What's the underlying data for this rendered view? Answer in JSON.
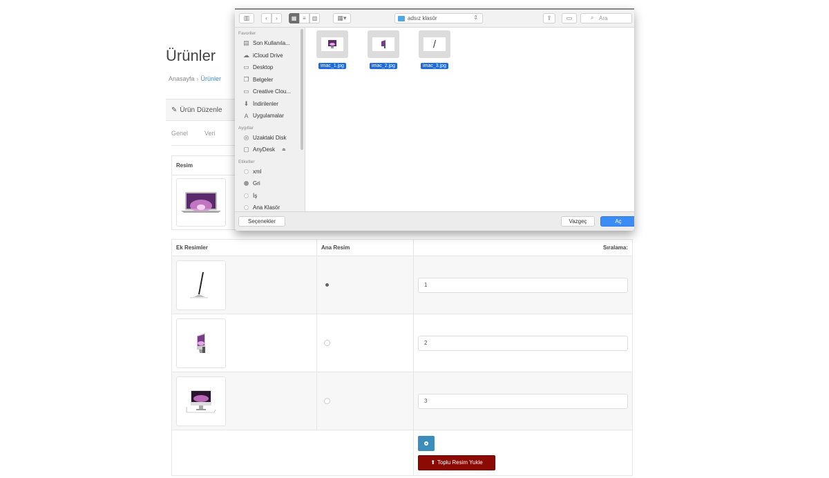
{
  "page": {
    "title": "Ürünler",
    "breadcrumb": [
      {
        "label": "Anasayfa"
      },
      {
        "label": "Ürünler"
      }
    ],
    "breadcrumb_separator": "›",
    "panel_title": "Ürün Düzenle",
    "panel_icon": "pencil-icon",
    "tabs": [
      {
        "label": "Genel"
      },
      {
        "label": "Veri"
      }
    ],
    "main_image": {
      "header": "Resim",
      "image": "macbook-air-image"
    },
    "additional_images": {
      "headers": {
        "images": "Ek Resimler",
        "main": "Ana Resim",
        "order": "Sıralama:"
      },
      "rows": [
        {
          "image": "imac-side-image",
          "is_main": true,
          "order": "1"
        },
        {
          "image": "imac-angle-image",
          "is_main": false,
          "order": "2"
        },
        {
          "image": "imac-front-image",
          "is_main": false,
          "order": "3"
        }
      ],
      "add_button_icon": "plus-circle-icon",
      "bulk_upload_label": "Toplu Resim Yukle",
      "bulk_upload_icon": "upload-icon"
    },
    "colors": {
      "link": "#3c8dbc",
      "add_button": "#3c8dbc",
      "upload_button": "#8b0b04"
    }
  },
  "dialog": {
    "location": "adsız klasör",
    "search_placeholder": "Ara",
    "toolbar_icons": [
      "sidebar-toggle-icon",
      "back-icon",
      "forward-icon",
      "icon-view-icon",
      "list-view-icon",
      "column-view-icon",
      "gallery-view-icon",
      "share-icon",
      "tag-icon",
      "search-icon"
    ],
    "sidebar": {
      "favorites_label": "Favoriler",
      "favorites": [
        {
          "label": "Son Kullanıla...",
          "icon": "recents-icon"
        },
        {
          "label": "iCloud Drive",
          "icon": "cloud-icon"
        },
        {
          "label": "Desktop",
          "icon": "desktop-icon"
        },
        {
          "label": "Belgeler",
          "icon": "documents-icon"
        },
        {
          "label": "Creative Clou...",
          "icon": "folder-icon"
        },
        {
          "label": "İndirilenler",
          "icon": "download-icon"
        },
        {
          "label": "Uygulamalar",
          "icon": "applications-icon"
        }
      ],
      "devices_label": "Aygıtlar",
      "devices": [
        {
          "label": "Uzaktaki Disk",
          "icon": "disc-icon"
        },
        {
          "label": "AnyDesk",
          "icon": "drive-icon",
          "eject": "⏏"
        }
      ],
      "tags_label": "Etiketler",
      "tags": [
        {
          "label": "xml",
          "color": "none"
        },
        {
          "label": "Gri",
          "color": "#999999"
        },
        {
          "label": "İş",
          "color": "none"
        },
        {
          "label": "Ana Klasör",
          "color": "none"
        }
      ]
    },
    "files": [
      {
        "name": "imac_1.jpg",
        "selected": true
      },
      {
        "name": "imac_2.jpg",
        "selected": true
      },
      {
        "name": "imac_3.jpg",
        "selected": true
      }
    ],
    "buttons": {
      "options": "Seçenekler",
      "cancel": "Vazgeç",
      "open": "Aç"
    },
    "colors": {
      "selection": "#1b6ae0",
      "primary_button": "#3b8cf4"
    }
  }
}
